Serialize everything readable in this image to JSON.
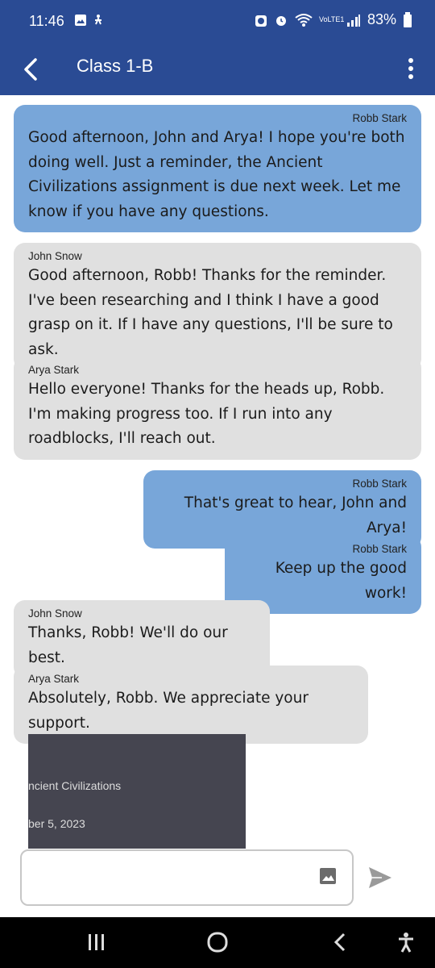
{
  "status_bar": {
    "time": "11:46",
    "battery": "83%",
    "network_label": "VoLTE1"
  },
  "header": {
    "title": "Class 1-B"
  },
  "messages": [
    {
      "sender": "Robb Stark",
      "direction": "out",
      "text": "Good afternoon, John and Arya! I hope you're both doing well. Just a reminder, the Ancient Civilizations assignment is due next week. Let me know if you have any questions."
    },
    {
      "sender": "John Snow",
      "direction": "in",
      "text": "Good afternoon, Robb! Thanks for the reminder. I've been researching and I think I have a good grasp on it. If I have any questions, I'll be sure to ask."
    },
    {
      "sender": "Arya Stark",
      "direction": "in",
      "text": "Hello everyone! Thanks for the heads up, Robb. I'm making progress too. If I run into any roadblocks, I'll reach out."
    },
    {
      "sender": "Robb Stark",
      "direction": "out",
      "text": "That's great to hear, John and Arya!"
    },
    {
      "sender": "Robb Stark",
      "direction": "out",
      "text": "Keep up the good work!"
    },
    {
      "sender": "John Snow",
      "direction": "in",
      "text": "Thanks, Robb! We'll do our best."
    },
    {
      "sender": "Arya Stark",
      "direction": "in",
      "text": "Absolutely, Robb. We appreciate your support."
    }
  ],
  "attachment": {
    "title_fragment": "ncient Civilizations",
    "date_fragment": "ber 5, 2023"
  },
  "composer": {
    "value": "",
    "placeholder": ""
  },
  "colors": {
    "header_bg": "#2a4b94",
    "outgoing_bubble": "#78a6d9",
    "incoming_bubble": "#e0e0e0"
  }
}
